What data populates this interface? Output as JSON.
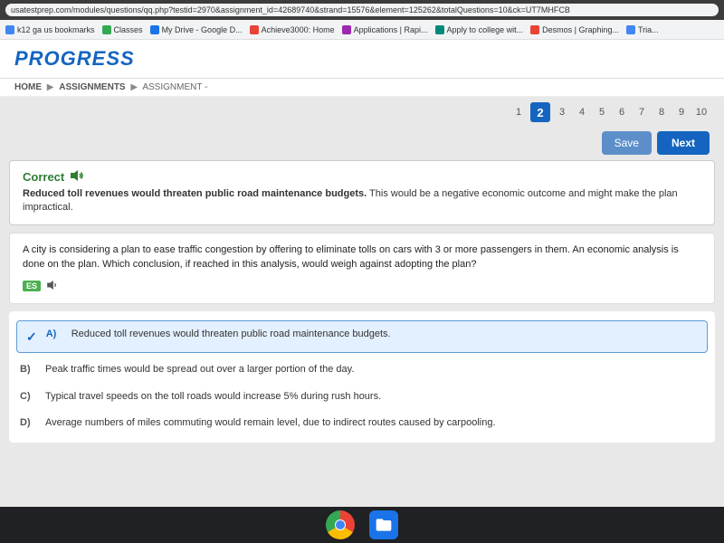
{
  "browser": {
    "url": "usatestprep.com/modules/questions/qq.php?testid=2970&assignment_id=42689740&strand=15576&element=125262&totalQuestions=10&ck=UT7MHFCB"
  },
  "bookmarks": [
    {
      "label": "k12 ga us bookmarks",
      "color": "blue"
    },
    {
      "label": "Classes",
      "color": "green"
    },
    {
      "label": "My Drive - Google D...",
      "color": "blue2"
    },
    {
      "label": "Achieve3000: Home",
      "color": "orange"
    },
    {
      "label": "Applications | Rapi...",
      "color": "purple"
    },
    {
      "label": "Apply to college wit...",
      "color": "teal"
    },
    {
      "label": "Desmos | Graphing...",
      "color": "orange"
    },
    {
      "label": "Tria...",
      "color": "blue"
    }
  ],
  "header": {
    "logo": "PROGRESS"
  },
  "breadcrumb": {
    "home": "HOME",
    "sep1": "▶",
    "assignments": "ASSIGNMENTS",
    "sep2": "▶",
    "current": "ASSIGNMENT -"
  },
  "pagination": {
    "pages": [
      "1",
      "2",
      "3",
      "4",
      "5",
      "6",
      "7",
      "8",
      "9",
      "10"
    ],
    "active": "2"
  },
  "buttons": {
    "save": "Save",
    "next": "Next"
  },
  "correct_box": {
    "label": "Correct",
    "bold_text": "Reduced toll revenues would threaten public road maintenance budgets.",
    "rest_text": " This would be a negative economic outcome and might make the plan impractical."
  },
  "question": {
    "text": "A city is considering a plan to ease traffic congestion by offering to eliminate tolls on cars with 3 or more passengers in them. An economic analysis is done on the plan. Which conclusion, if reached in this analysis, would weigh against adopting the plan?"
  },
  "answers": [
    {
      "letter": "A)",
      "text": "Reduced toll revenues would threaten public road maintenance budgets.",
      "selected": true
    },
    {
      "letter": "B)",
      "text": "Peak traffic times would be spread out over a larger portion of the day.",
      "selected": false
    },
    {
      "letter": "C)",
      "text": "Typical travel speeds on the toll roads would increase 5% during rush hours.",
      "selected": false
    },
    {
      "letter": "D)",
      "text": "Average numbers of miles commuting would remain level, due to indirect routes caused by carpooling.",
      "selected": false
    }
  ],
  "taskbar": {
    "chrome_title": "Chrome",
    "files_title": "Files"
  }
}
